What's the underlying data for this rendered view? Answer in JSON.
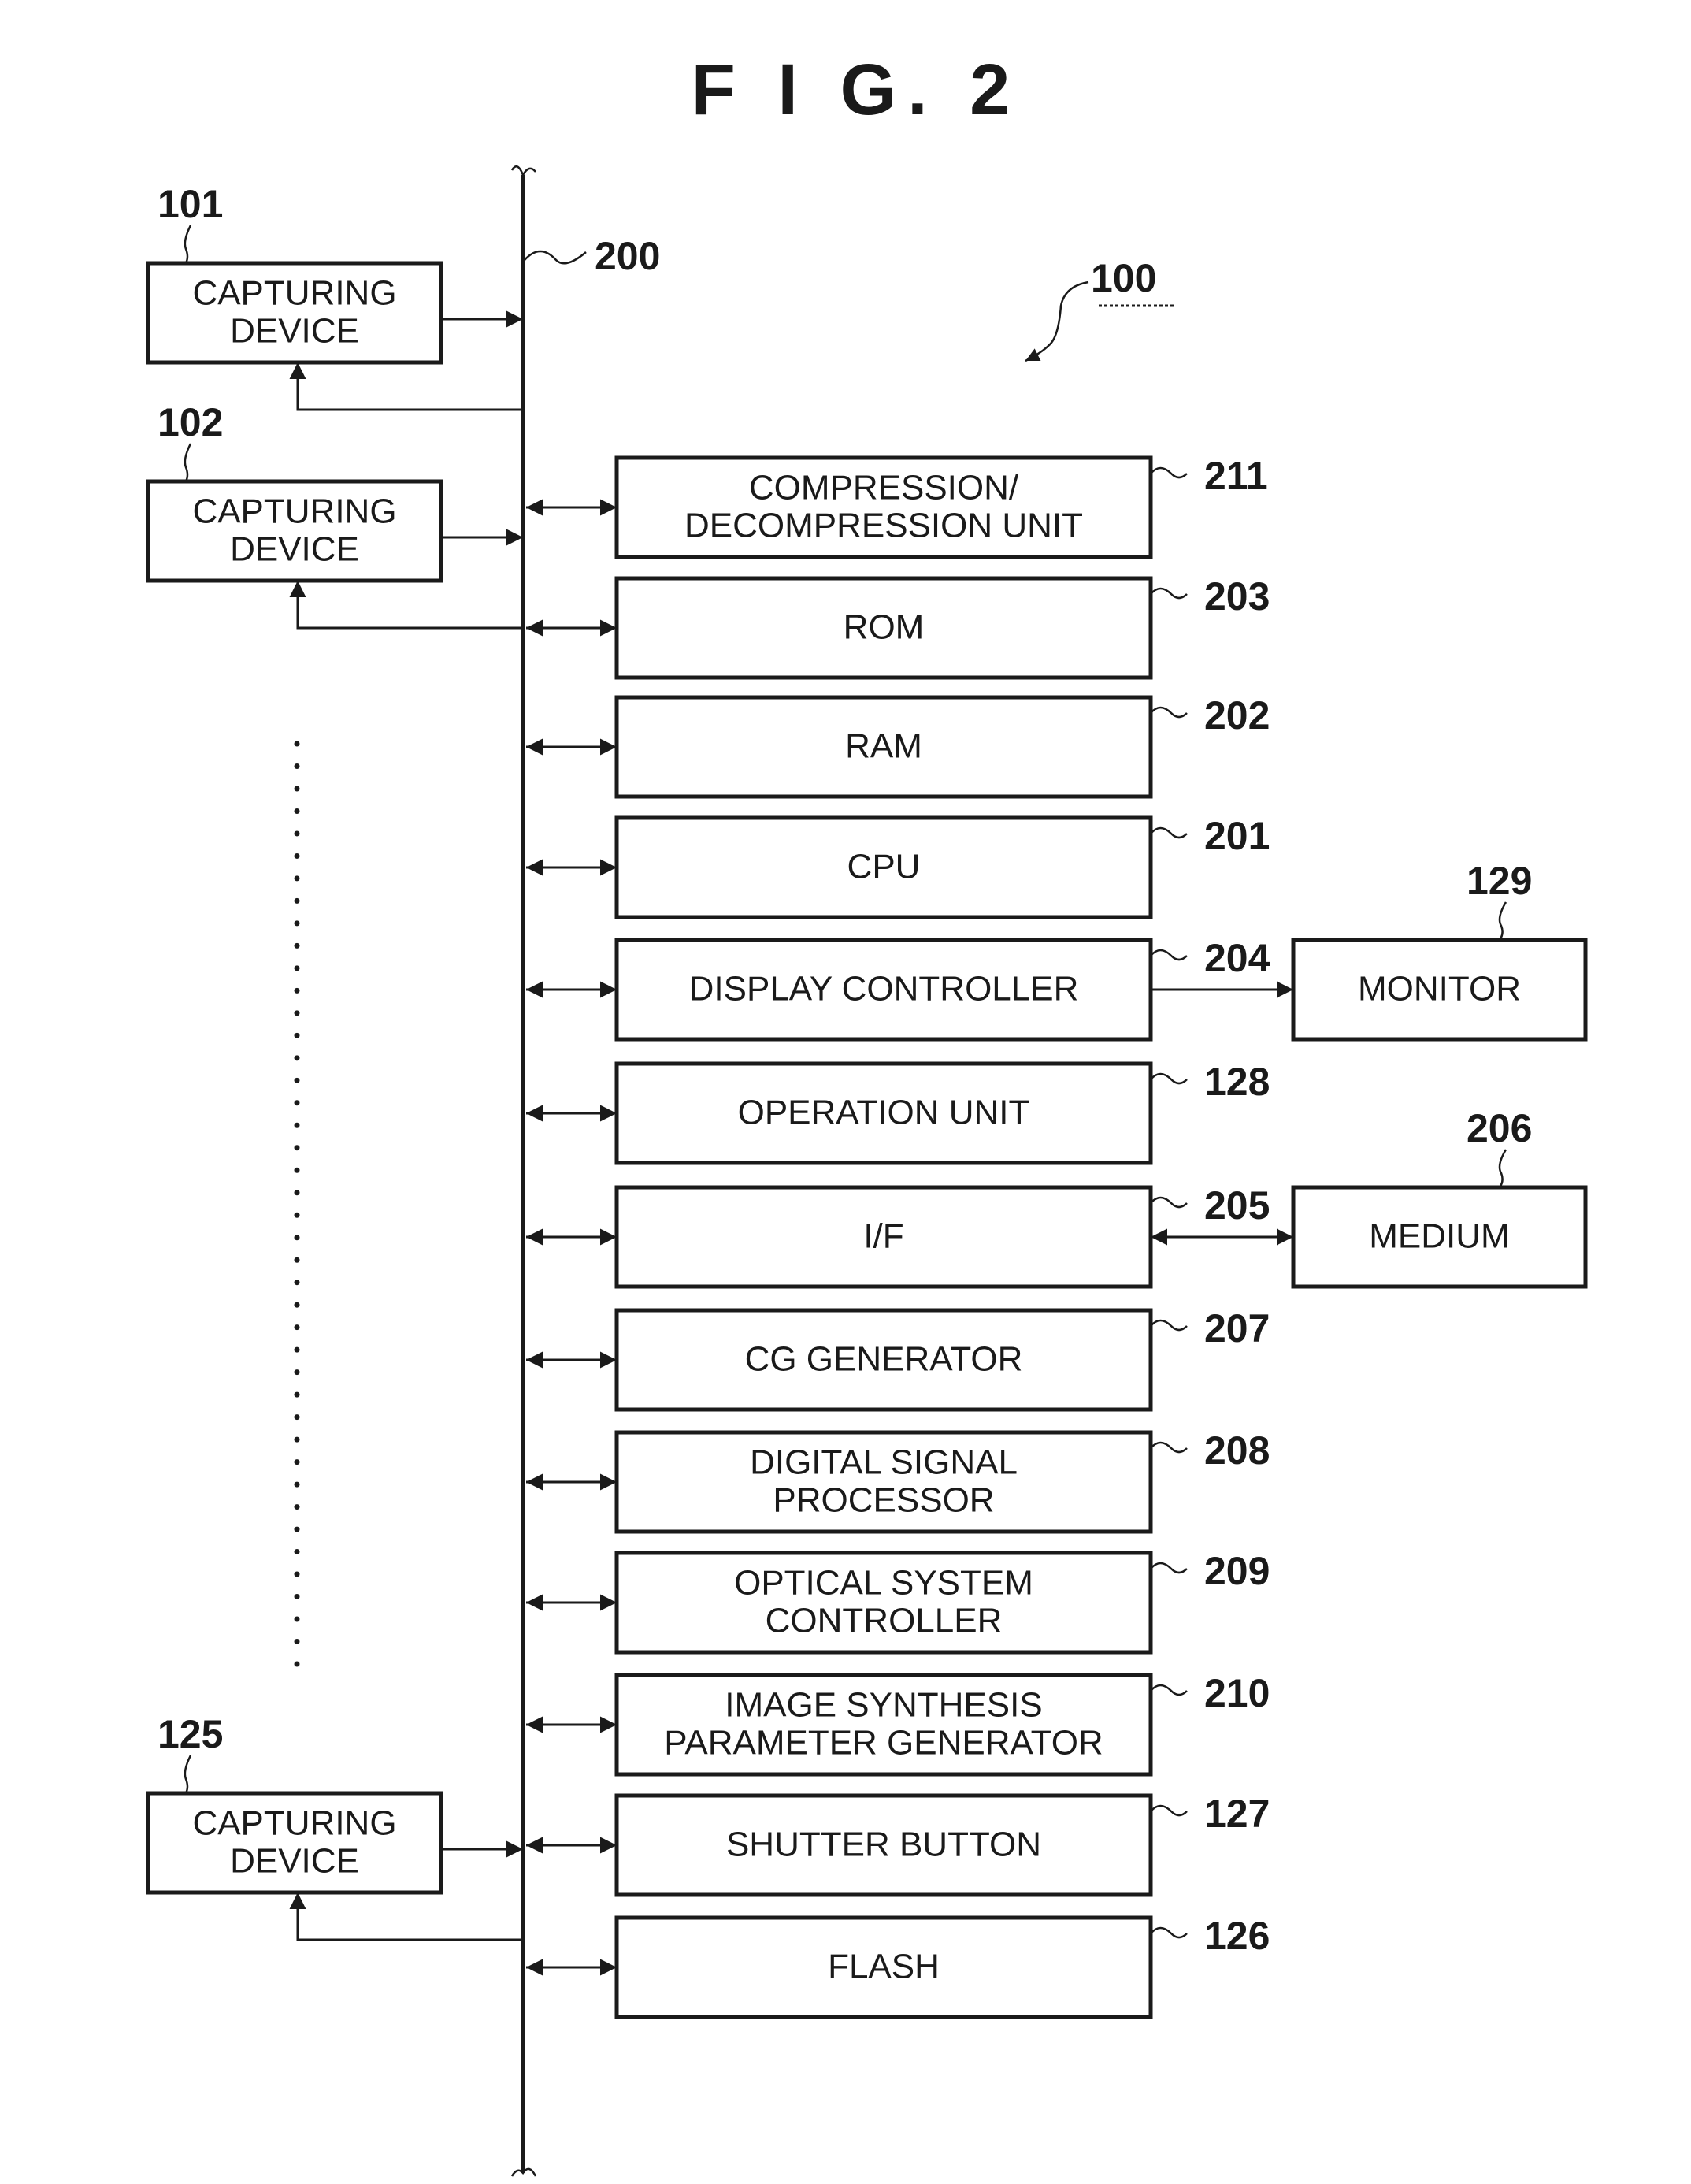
{
  "figure_title": "F I G. 2",
  "system_ref": "100",
  "bus_ref": "200",
  "capturing_devices": [
    {
      "ref": "101",
      "lines": [
        "CAPTURING",
        "DEVICE"
      ]
    },
    {
      "ref": "102",
      "lines": [
        "CAPTURING",
        "DEVICE"
      ]
    },
    {
      "ref": "125",
      "lines": [
        "CAPTURING",
        "DEVICE"
      ]
    }
  ],
  "units": [
    {
      "ref": "211",
      "lines": [
        "COMPRESSION/",
        "DECOMPRESSION UNIT"
      ]
    },
    {
      "ref": "203",
      "lines": [
        "ROM"
      ]
    },
    {
      "ref": "202",
      "lines": [
        "RAM"
      ]
    },
    {
      "ref": "201",
      "lines": [
        "CPU"
      ]
    },
    {
      "ref": "204",
      "lines": [
        "DISPLAY CONTROLLER"
      ]
    },
    {
      "ref": "128",
      "lines": [
        "OPERATION UNIT"
      ]
    },
    {
      "ref": "205",
      "lines": [
        "I/F"
      ]
    },
    {
      "ref": "207",
      "lines": [
        "CG GENERATOR"
      ]
    },
    {
      "ref": "208",
      "lines": [
        "DIGITAL SIGNAL",
        "PROCESSOR"
      ]
    },
    {
      "ref": "209",
      "lines": [
        "OPTICAL SYSTEM",
        "CONTROLLER"
      ]
    },
    {
      "ref": "210",
      "lines": [
        "IMAGE SYNTHESIS",
        "PARAMETER GENERATOR"
      ]
    },
    {
      "ref": "127",
      "lines": [
        "SHUTTER BUTTON"
      ]
    },
    {
      "ref": "126",
      "lines": [
        "FLASH"
      ]
    }
  ],
  "peripherals": [
    {
      "ref": "129",
      "lines": [
        "MONITOR"
      ],
      "connects_to": "204",
      "direction": "one-way"
    },
    {
      "ref": "206",
      "lines": [
        "MEDIUM"
      ],
      "connects_to": "205",
      "direction": "two-way"
    }
  ],
  "ellipsis": "vertical dotted continuation between capturing devices 102 and 125"
}
